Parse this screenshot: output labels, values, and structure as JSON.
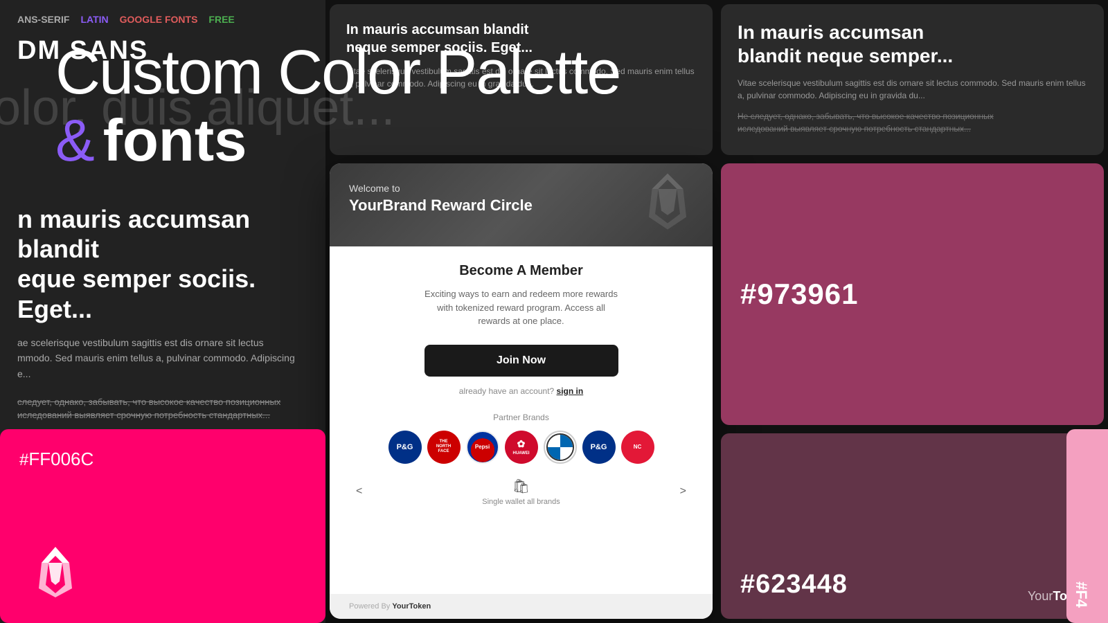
{
  "page": {
    "background_color": "#111111"
  },
  "overlay_title": {
    "line1": "Custom Color Palette",
    "line2_ampersand": "&",
    "line2_text": "fonts"
  },
  "font_demo_card": {
    "tags": [
      "ANS-SERIF",
      "LATIN",
      "GOOGLE FONTS",
      "FREE"
    ],
    "font_name": "DM SANS",
    "sample_text": "olor, duis aliquet...",
    "heading": "n mauris accumsan blandit\neque semper sociis. Eget...",
    "body_text": "ae scelerisque vestibulum sagittis est dis ornare sit lectus\nmmodo. Sed mauris enim tellus a, pulvinar commodo. Adipiscing e...",
    "strikethrough_text": "следует, однако, забывать, что высокое качество позиционных\nиследований выявляет срочную потребность стандартных..."
  },
  "top_mid_card": {
    "title": "In mauris accumsan blandit\nneque semper sociis. Eget...",
    "body": "Vitae scelerisque vestibulum sagittis est dis ornare sit lectus commodo. Sed mauris enim tellus a, pulvinar commodo. Adipiscing eu in gravida du..."
  },
  "reward_card": {
    "welcome_text": "Welcome to",
    "brand_name": "YourBrand Reward Circle",
    "section_title": "Become A Member",
    "description": "Exciting ways to earn and redeem more rewards with tokenized reward program. Access all rewards at one place.",
    "join_button": "Join Now",
    "signin_prompt": "already have an account?",
    "signin_link": "sign in",
    "partner_section_label": "Partner Brands",
    "partners": [
      {
        "name": "P&G",
        "bg": "#003087",
        "text": "P&G"
      },
      {
        "name": "The North Face",
        "bg": "#cc0000",
        "text": "TNF"
      },
      {
        "name": "Pepsi",
        "bg": "#cc0000",
        "text": "Pepsi"
      },
      {
        "name": "Huawei",
        "bg": "#cf0a2c",
        "text": "HUAWEI"
      },
      {
        "name": "BMW",
        "bg": "#0066b1",
        "text": "BMW"
      },
      {
        "name": "P&G2",
        "bg": "#003087",
        "text": "P&G"
      },
      {
        "name": "NC",
        "bg": "#e31837",
        "text": "NC"
      }
    ],
    "wallet_nav_left": "<",
    "wallet_nav_right": ">",
    "wallet_label": "Single wallet all brands",
    "powered_by_prefix": "Powered By ",
    "powered_by_brand": "YourToken"
  },
  "top_right_card": {
    "title": "In mauris accumsan\nblandit neque semper...",
    "body": "Vitae scelerisque vestibulum sagittis est dis ornare sit lectus commodo. Sed mauris enim tellus a, pulvinar commodo. Adipiscing eu in gravida du...",
    "strikethrough": "Не следует, однако, забывать, что высокое качество позиционных\nиследований выявляет срочную потребность стандартных..."
  },
  "color_card_1": {
    "hex": "#973961",
    "bg": "#973961"
  },
  "color_card_pink": {
    "hex_prefix": "#",
    "hex": "FF006C",
    "bg": "#ff006c"
  },
  "color_card_2": {
    "hex": "#623448",
    "bg": "#623448",
    "yourtoken_normal": "Your",
    "yourtoken_bold": "Token"
  },
  "color_card_partial": {
    "hex_partial": "#F4",
    "bg": "#f4a0c0"
  }
}
